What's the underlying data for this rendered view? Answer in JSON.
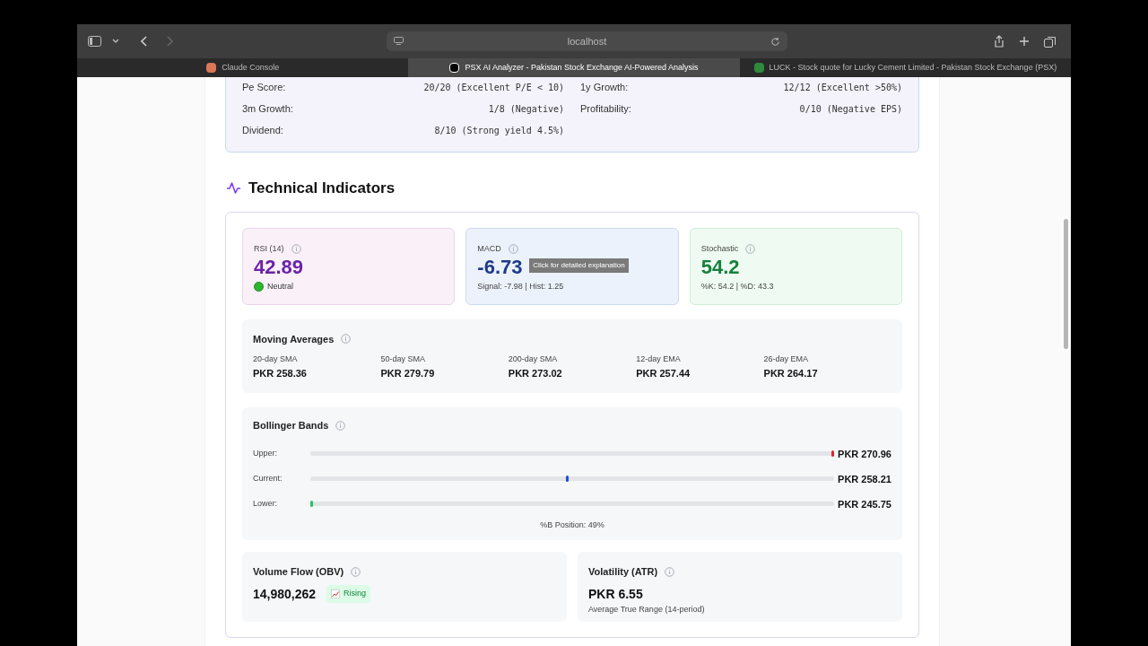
{
  "browser": {
    "address": "localhost",
    "tabs": [
      {
        "title": "Claude Console",
        "selected": false
      },
      {
        "title": "PSX AI Analyzer - Pakistan Stock Exchange AI-Powered Analysis",
        "selected": true
      },
      {
        "title": "LUCK - Stock quote for Lucky Cement Limited - Pakistan Stock Exchange (PSX)",
        "selected": false
      }
    ]
  },
  "scores": [
    {
      "label": "Pe Score:",
      "value": "20/20 (Excellent P/E < 10)"
    },
    {
      "label": "1y Growth:",
      "value": "12/12 (Excellent >50%)"
    },
    {
      "label": "3m Growth:",
      "value": "1/8 (Negative)"
    },
    {
      "label": "Profitability:",
      "value": "0/10 (Negative EPS)"
    },
    {
      "label": "Dividend:",
      "value": "8/10 (Strong yield 4.5%)"
    }
  ],
  "section_title": "Technical Indicators",
  "indicators": [
    {
      "label": "RSI (14)",
      "value": "42.89",
      "color": "#6b21a8",
      "detail": "Neutral",
      "kind": "status"
    },
    {
      "label": "MACD",
      "value": "-6.73",
      "color": "#1e3a8a",
      "detail": "Signal: -7.98 | Hist: 1.25",
      "kind": "text",
      "tooltip": "Click for detailed explanation"
    },
    {
      "label": "Stochastic",
      "value": "54.2",
      "color": "#15803d",
      "detail": "%K: 54.2 | %D: 43.3",
      "kind": "text"
    }
  ],
  "moving_averages": {
    "title": "Moving Averages",
    "items": [
      {
        "label": "20-day SMA",
        "value": "PKR 258.36"
      },
      {
        "label": "50-day SMA",
        "value": "PKR 279.79"
      },
      {
        "label": "200-day SMA",
        "value": "PKR 273.02"
      },
      {
        "label": "12-day EMA",
        "value": "PKR 257.44"
      },
      {
        "label": "26-day EMA",
        "value": "PKR 264.17"
      }
    ]
  },
  "bollinger": {
    "title": "Bollinger Bands",
    "bands": [
      {
        "label": "Upper:",
        "value": "PKR 270.96",
        "level": 1.0,
        "color": "#dc2626"
      },
      {
        "label": "Current:",
        "value": "PKR 258.21",
        "level": 0.49,
        "color": "#1d4ed8"
      },
      {
        "label": "Lower:",
        "value": "PKR 245.75",
        "level": 0.0,
        "color": "#22c55e"
      }
    ],
    "position": "%B Position: 49%"
  },
  "obv": {
    "title": "Volume Flow (OBV)",
    "value": "14,980,262",
    "trend": "Rising"
  },
  "atr": {
    "title": "Volatility (ATR)",
    "value": "PKR 6.55",
    "note": "Average True Range (14-period)"
  }
}
